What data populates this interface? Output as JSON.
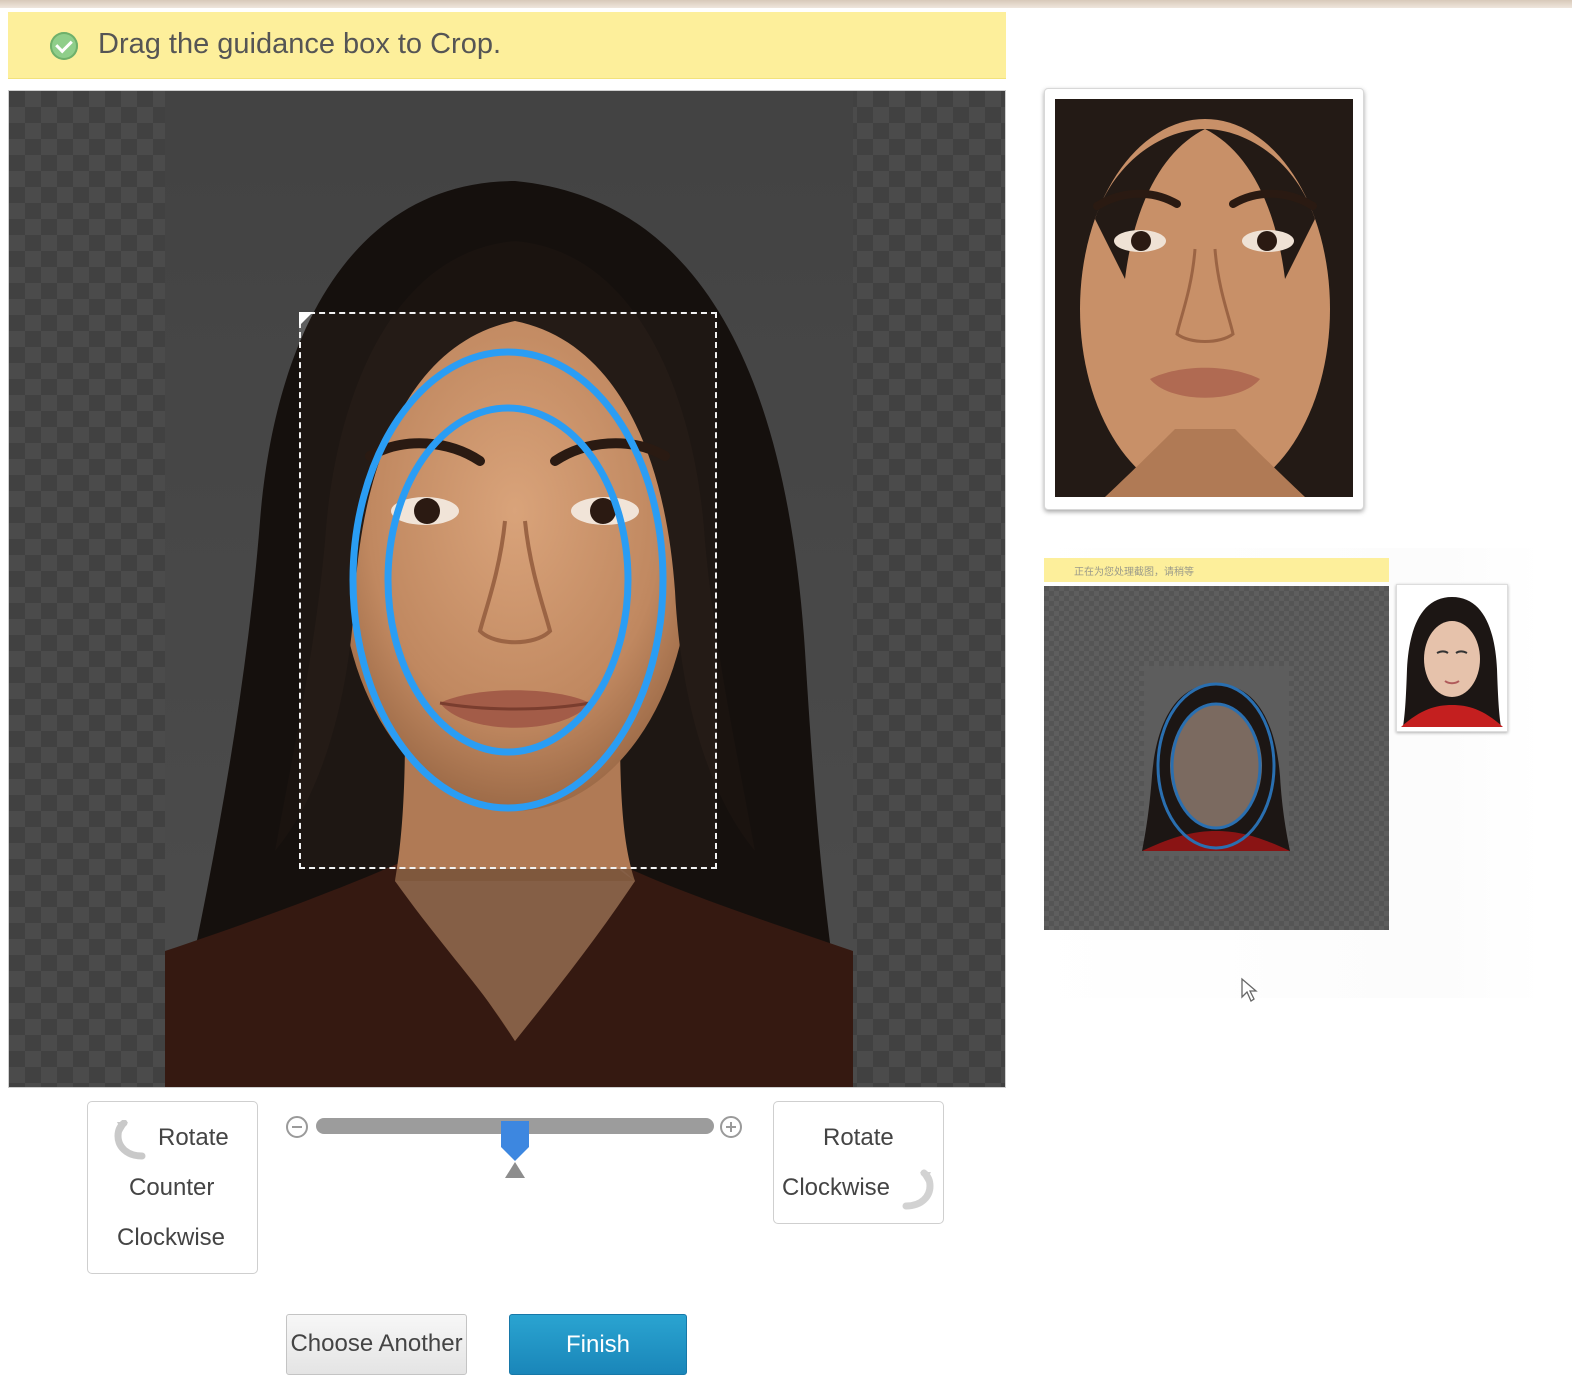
{
  "notice": {
    "text": "Drag the guidance box to Crop.",
    "icon": "check-circle-icon"
  },
  "editor": {
    "guide_color": "#2a9df4",
    "zoom": {
      "value_fraction": 0.5
    }
  },
  "controls": {
    "rotate_ccw": {
      "line1": "Rotate",
      "line2": "Counter",
      "line3": "Clockwise",
      "icon": "rotate-ccw-icon"
    },
    "rotate_cw": {
      "line1": "Rotate",
      "line2": "Clockwise",
      "icon": "rotate-cw-icon"
    },
    "zoom_out_icon": "zoom-out-icon",
    "zoom_in_icon": "zoom-in-icon"
  },
  "actions": {
    "choose_another": "Choose Another",
    "finish": "Finish",
    "finish_color": "#1f95c6"
  },
  "demo": {
    "bar_text": "正在为您处理截图，请稍等"
  }
}
